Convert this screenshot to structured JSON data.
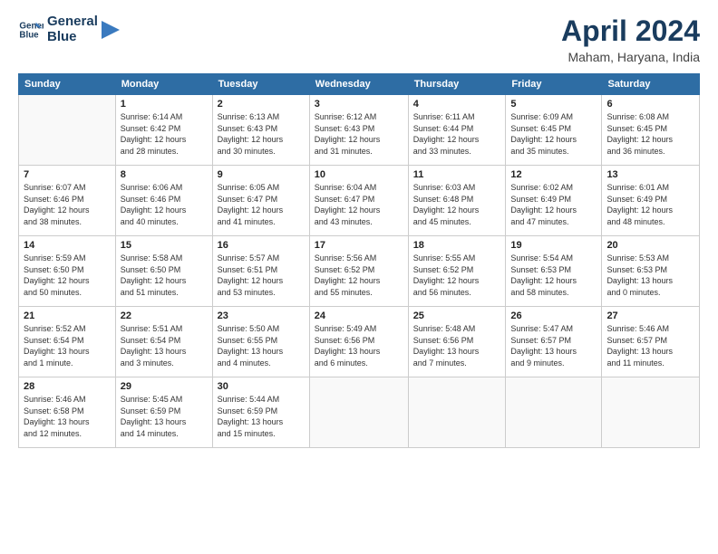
{
  "logo": {
    "text_line1": "General",
    "text_line2": "Blue"
  },
  "header": {
    "month": "April 2024",
    "location": "Maham, Haryana, India"
  },
  "weekdays": [
    "Sunday",
    "Monday",
    "Tuesday",
    "Wednesday",
    "Thursday",
    "Friday",
    "Saturday"
  ],
  "weeks": [
    [
      {
        "day": "",
        "info": ""
      },
      {
        "day": "1",
        "info": "Sunrise: 6:14 AM\nSunset: 6:42 PM\nDaylight: 12 hours\nand 28 minutes."
      },
      {
        "day": "2",
        "info": "Sunrise: 6:13 AM\nSunset: 6:43 PM\nDaylight: 12 hours\nand 30 minutes."
      },
      {
        "day": "3",
        "info": "Sunrise: 6:12 AM\nSunset: 6:43 PM\nDaylight: 12 hours\nand 31 minutes."
      },
      {
        "day": "4",
        "info": "Sunrise: 6:11 AM\nSunset: 6:44 PM\nDaylight: 12 hours\nand 33 minutes."
      },
      {
        "day": "5",
        "info": "Sunrise: 6:09 AM\nSunset: 6:45 PM\nDaylight: 12 hours\nand 35 minutes."
      },
      {
        "day": "6",
        "info": "Sunrise: 6:08 AM\nSunset: 6:45 PM\nDaylight: 12 hours\nand 36 minutes."
      }
    ],
    [
      {
        "day": "7",
        "info": "Sunrise: 6:07 AM\nSunset: 6:46 PM\nDaylight: 12 hours\nand 38 minutes."
      },
      {
        "day": "8",
        "info": "Sunrise: 6:06 AM\nSunset: 6:46 PM\nDaylight: 12 hours\nand 40 minutes."
      },
      {
        "day": "9",
        "info": "Sunrise: 6:05 AM\nSunset: 6:47 PM\nDaylight: 12 hours\nand 41 minutes."
      },
      {
        "day": "10",
        "info": "Sunrise: 6:04 AM\nSunset: 6:47 PM\nDaylight: 12 hours\nand 43 minutes."
      },
      {
        "day": "11",
        "info": "Sunrise: 6:03 AM\nSunset: 6:48 PM\nDaylight: 12 hours\nand 45 minutes."
      },
      {
        "day": "12",
        "info": "Sunrise: 6:02 AM\nSunset: 6:49 PM\nDaylight: 12 hours\nand 47 minutes."
      },
      {
        "day": "13",
        "info": "Sunrise: 6:01 AM\nSunset: 6:49 PM\nDaylight: 12 hours\nand 48 minutes."
      }
    ],
    [
      {
        "day": "14",
        "info": "Sunrise: 5:59 AM\nSunset: 6:50 PM\nDaylight: 12 hours\nand 50 minutes."
      },
      {
        "day": "15",
        "info": "Sunrise: 5:58 AM\nSunset: 6:50 PM\nDaylight: 12 hours\nand 51 minutes."
      },
      {
        "day": "16",
        "info": "Sunrise: 5:57 AM\nSunset: 6:51 PM\nDaylight: 12 hours\nand 53 minutes."
      },
      {
        "day": "17",
        "info": "Sunrise: 5:56 AM\nSunset: 6:52 PM\nDaylight: 12 hours\nand 55 minutes."
      },
      {
        "day": "18",
        "info": "Sunrise: 5:55 AM\nSunset: 6:52 PM\nDaylight: 12 hours\nand 56 minutes."
      },
      {
        "day": "19",
        "info": "Sunrise: 5:54 AM\nSunset: 6:53 PM\nDaylight: 12 hours\nand 58 minutes."
      },
      {
        "day": "20",
        "info": "Sunrise: 5:53 AM\nSunset: 6:53 PM\nDaylight: 13 hours\nand 0 minutes."
      }
    ],
    [
      {
        "day": "21",
        "info": "Sunrise: 5:52 AM\nSunset: 6:54 PM\nDaylight: 13 hours\nand 1 minute."
      },
      {
        "day": "22",
        "info": "Sunrise: 5:51 AM\nSunset: 6:54 PM\nDaylight: 13 hours\nand 3 minutes."
      },
      {
        "day": "23",
        "info": "Sunrise: 5:50 AM\nSunset: 6:55 PM\nDaylight: 13 hours\nand 4 minutes."
      },
      {
        "day": "24",
        "info": "Sunrise: 5:49 AM\nSunset: 6:56 PM\nDaylight: 13 hours\nand 6 minutes."
      },
      {
        "day": "25",
        "info": "Sunrise: 5:48 AM\nSunset: 6:56 PM\nDaylight: 13 hours\nand 7 minutes."
      },
      {
        "day": "26",
        "info": "Sunrise: 5:47 AM\nSunset: 6:57 PM\nDaylight: 13 hours\nand 9 minutes."
      },
      {
        "day": "27",
        "info": "Sunrise: 5:46 AM\nSunset: 6:57 PM\nDaylight: 13 hours\nand 11 minutes."
      }
    ],
    [
      {
        "day": "28",
        "info": "Sunrise: 5:46 AM\nSunset: 6:58 PM\nDaylight: 13 hours\nand 12 minutes."
      },
      {
        "day": "29",
        "info": "Sunrise: 5:45 AM\nSunset: 6:59 PM\nDaylight: 13 hours\nand 14 minutes."
      },
      {
        "day": "30",
        "info": "Sunrise: 5:44 AM\nSunset: 6:59 PM\nDaylight: 13 hours\nand 15 minutes."
      },
      {
        "day": "",
        "info": ""
      },
      {
        "day": "",
        "info": ""
      },
      {
        "day": "",
        "info": ""
      },
      {
        "day": "",
        "info": ""
      }
    ]
  ]
}
